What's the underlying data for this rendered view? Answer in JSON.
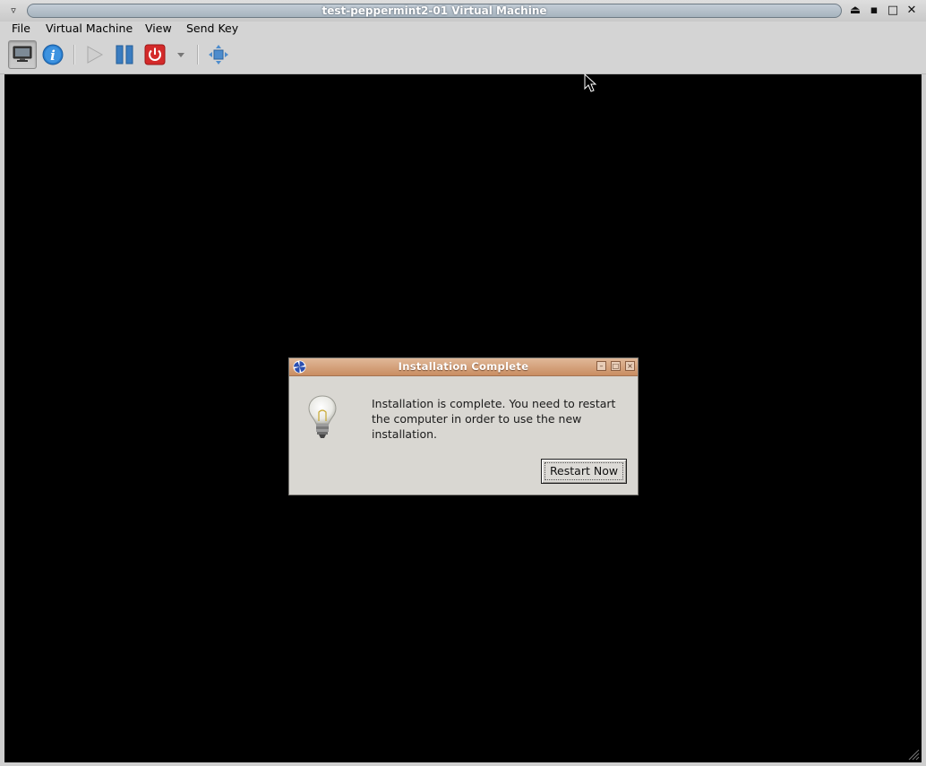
{
  "window": {
    "title": "test-peppermint2-01 Virtual Machine",
    "menu_button": "▿",
    "controls": [
      "⏏",
      "▪",
      "□",
      "✕"
    ]
  },
  "menubar": {
    "items": [
      "File",
      "Virtual Machine",
      "View",
      "Send Key"
    ]
  },
  "toolbar": {
    "icons": [
      "console-icon",
      "details-icon",
      "run-icon",
      "pause-icon",
      "shutdown-icon",
      "shutdown-menu-arrow-icon",
      "fullscreen-icon"
    ]
  },
  "dialog": {
    "title": "Installation Complete",
    "message": "Installation is complete. You need to restart the computer in order to use the new installation.",
    "button_label": "Restart Now",
    "controls": [
      "–",
      "□",
      "×"
    ]
  },
  "colors": {
    "vm_background": "#000000",
    "dialog_titlebar": "#d8a580",
    "shutdown_red": "#d42a2a",
    "info_blue": "#2a7fd0",
    "pause_blue": "#3a7cc0"
  }
}
